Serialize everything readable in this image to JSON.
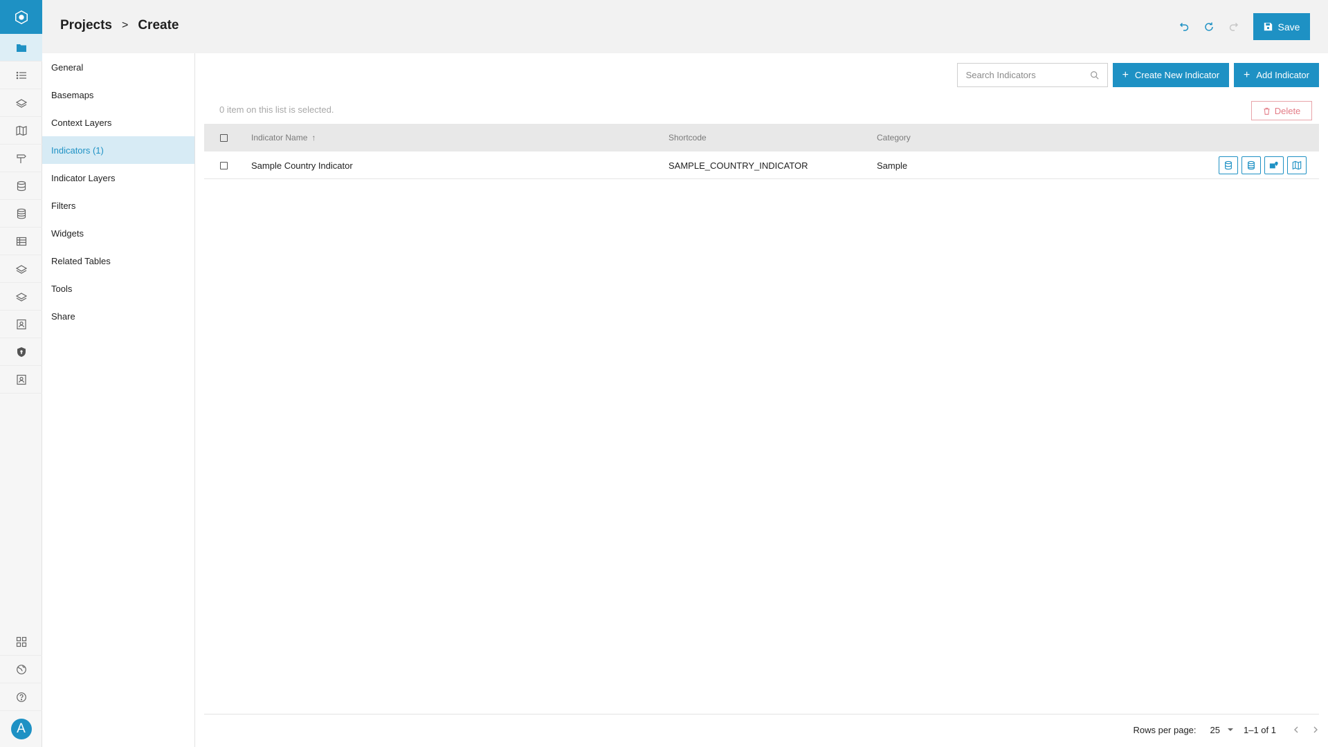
{
  "rail": {
    "logo_icon": "hexagon-logo-icon",
    "items": [
      {
        "icon": "folder-icon",
        "active": true
      },
      {
        "icon": "list-icon"
      },
      {
        "icon": "layers-icon"
      },
      {
        "icon": "map-icon"
      },
      {
        "icon": "signpost-icon"
      },
      {
        "icon": "database-icon"
      },
      {
        "icon": "database-stack-icon"
      },
      {
        "icon": "table-icon"
      },
      {
        "icon": "layers-outline-icon"
      },
      {
        "icon": "layers-outline-alt-icon"
      },
      {
        "icon": "contact-card-icon"
      },
      {
        "icon": "shield-icon"
      },
      {
        "icon": "contact-card-alt-icon"
      }
    ],
    "bottom_items": [
      {
        "icon": "grid-icon"
      },
      {
        "icon": "globe-icon"
      },
      {
        "icon": "help-icon"
      }
    ],
    "avatar_letter": "A"
  },
  "header": {
    "breadcrumb_root": "Projects",
    "breadcrumb_separator": ">",
    "breadcrumb_current": "Create",
    "save_label": "Save"
  },
  "subnav": {
    "items": [
      {
        "label": "General"
      },
      {
        "label": "Basemaps"
      },
      {
        "label": "Context Layers"
      },
      {
        "label": "Indicators (1)",
        "active": true
      },
      {
        "label": "Indicator Layers"
      },
      {
        "label": "Filters"
      },
      {
        "label": "Widgets"
      },
      {
        "label": "Related Tables"
      },
      {
        "label": "Tools"
      },
      {
        "label": "Share"
      }
    ]
  },
  "toolbar": {
    "search_placeholder": "Search Indicators",
    "create_new_label": "Create New Indicator",
    "add_label": "Add Indicator",
    "selection_note": "0 item on this list is selected.",
    "delete_label": "Delete"
  },
  "table": {
    "columns": {
      "name": "Indicator Name",
      "shortcode": "Shortcode",
      "category": "Category"
    },
    "sort_indicator": "↑",
    "rows": [
      {
        "name": "Sample Country Indicator",
        "shortcode": "SAMPLE_COUNTRY_INDICATOR",
        "category": "Sample",
        "actions": [
          "database-icon",
          "database-edit-icon",
          "map-marker-icon",
          "map-icon"
        ]
      }
    ]
  },
  "footer": {
    "rows_per_page_label": "Rows per page:",
    "rows_per_page_value": "25",
    "range_text": "1–1 of 1"
  },
  "colors": {
    "accent": "#1e91c4",
    "delete": "#e37b86",
    "active_bg": "#d7ebf5"
  }
}
